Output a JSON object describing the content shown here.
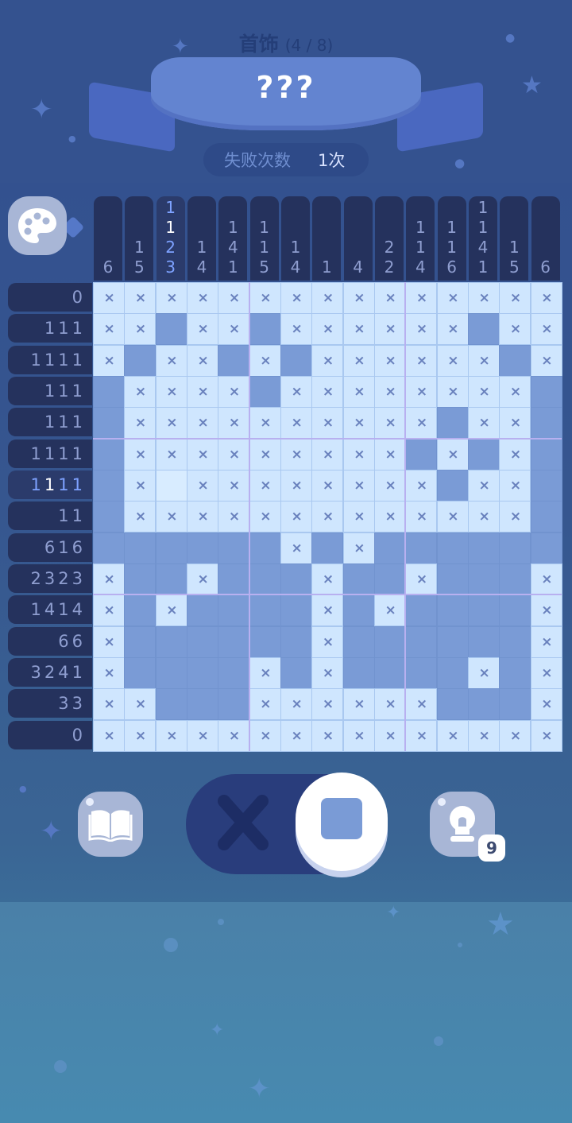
{
  "header": {
    "category_name": "首饰",
    "category_progress": "(4 / 8)",
    "puzzle_title": "???",
    "fail_label": "失败次数",
    "fail_value": "1次"
  },
  "puzzle": {
    "grid": [
      "xxxxxxxxxxxxxxx",
      "xx#xx#xxxxxx#xx",
      "x#xx#x#xxxxxx#x",
      "#xxxx#xxxxxxxx#",
      "#xxxxxxxxxx#xx#",
      "#xxxxxxxxx#x#x#",
      "#xoxxxxxxxx#xx#",
      "#xxxxxxxxxxxxx#",
      "######x#x######",
      "x##x###x##x###x",
      "x#x####x#x####x",
      "x######x######x",
      "x####x#x####x#x",
      "xx###xxxxxx###x",
      "xxxxxxxxxxxxxxx"
    ],
    "col_clues": [
      [
        "6"
      ],
      [
        "1",
        "5"
      ],
      [
        "1",
        "1",
        "2",
        "3"
      ],
      [
        "1",
        "4"
      ],
      [
        "1",
        "4",
        "1"
      ],
      [
        "1",
        "1",
        "5"
      ],
      [
        "1",
        "4"
      ],
      [
        "1"
      ],
      [
        "4"
      ],
      [
        "2",
        "2"
      ],
      [
        "1",
        "1",
        "4"
      ],
      [
        "1",
        "1",
        "6"
      ],
      [
        "1",
        "1",
        "4",
        "1"
      ],
      [
        "1",
        "5"
      ],
      [
        "6"
      ]
    ],
    "row_clues": [
      "0",
      "111",
      "1111",
      "111",
      "111",
      "1111",
      "1111",
      "11",
      "616",
      "2323",
      "1414",
      "66",
      "3241",
      "33",
      "0"
    ],
    "active_row": 6,
    "active_col": 2,
    "active_row_highlight_index": 1,
    "active_col_highlight_index": 1
  },
  "controls": {
    "hint_count": "9",
    "mode": "fill"
  },
  "icons": {
    "palette": "palette-icon",
    "book": "book-icon",
    "hint": "lightbulb-icon",
    "cross": "cross-icon",
    "fill": "fill-square-icon"
  },
  "colors": {
    "filled_cell": "#7a9bd6",
    "empty_cell": "#cfe6fe",
    "x_mark": "#6981bd",
    "clue_bg": "#25325d",
    "clue_text": "#8f9ed0",
    "active_clue_text": "#7ea2ff"
  }
}
